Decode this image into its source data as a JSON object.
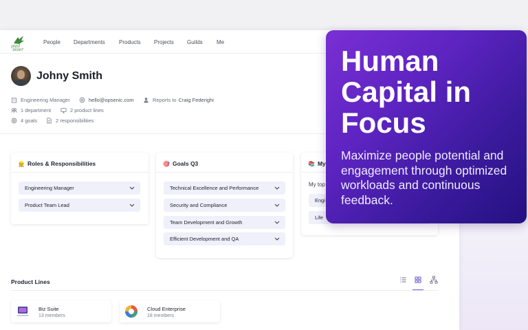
{
  "nav": {
    "logo_text": "pied piper",
    "items": [
      "People",
      "Departments",
      "Products",
      "Projects",
      "Guilds",
      "Me"
    ]
  },
  "profile": {
    "name": "Johny Smith",
    "title": "Engineering Manager",
    "email": "hello@opsenic.com",
    "reports_to_label": "Reports to",
    "reports_to": "Craig Federighi",
    "departments": "1 department",
    "product_lines": "2 product lines",
    "goals": "4 goals",
    "responsibilities": "2 responsibilities"
  },
  "cards": {
    "roles": {
      "emoji": "👷",
      "title": "Roles & Responsibilities",
      "items": [
        "Engineering Manager",
        "Product Team Lead"
      ]
    },
    "goals": {
      "emoji": "🎯",
      "title": "Goals Q3",
      "items": [
        "Technical Excellence and Performance",
        "Security and Compliance",
        "Team Development and Growth",
        "Efficient Development and QA"
      ]
    },
    "my": {
      "emoji": "📚",
      "title": "My l",
      "subtitle": "My top",
      "items": [
        "Engi",
        "Life"
      ]
    }
  },
  "product_lines": {
    "title": "Product Lines",
    "items": [
      {
        "name": "Biz Suite",
        "members": "13 members"
      },
      {
        "name": "Cloud Enterprise",
        "members": "18 members"
      }
    ],
    "views": [
      "list-view-icon",
      "grid-view-icon",
      "tree-view-icon"
    ],
    "active_view": "grid-view-icon"
  },
  "overlay": {
    "title": "Human Capital in Focus",
    "subtitle": "Maximize people potential and engagement through optimized workloads and continuous feedback."
  },
  "colors": {
    "accent": "#6a5acd",
    "overlay_start": "#7a2fd4",
    "overlay_end": "#241181",
    "pill_bg": "#eff0fa"
  }
}
